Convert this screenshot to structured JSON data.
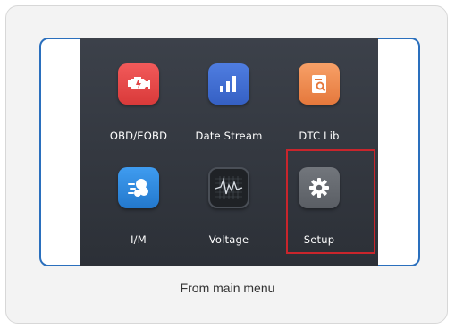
{
  "menu": {
    "items": [
      {
        "label": "OBD/EOBD",
        "icon": "engine-icon",
        "color": "#e84a4a"
      },
      {
        "label": "Date Stream",
        "icon": "bar-chart-icon",
        "color": "#3f6fd1"
      },
      {
        "label": "DTC Lib",
        "icon": "code-library-icon",
        "color": "#f08a4b"
      },
      {
        "label": "I/M",
        "icon": "readiness-icon",
        "color": "#2f8be0"
      },
      {
        "label": "Voltage",
        "icon": "voltage-waveform-icon",
        "color": "#1f2226"
      },
      {
        "label": "Setup",
        "icon": "gear-icon",
        "color": "#666a70"
      }
    ],
    "selected": "Setup",
    "selected_color": "#c9252c"
  },
  "caption": "From main menu",
  "frame_color": "#2a6fbd"
}
